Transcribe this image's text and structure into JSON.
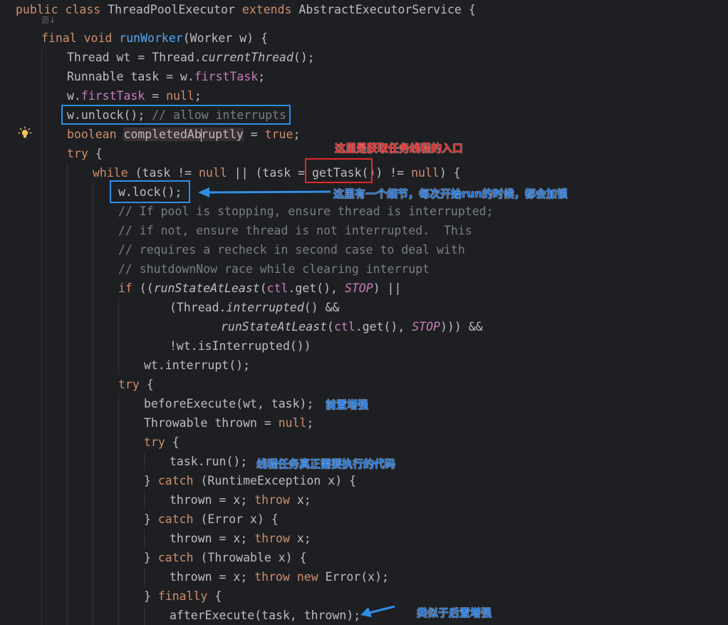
{
  "code": {
    "class_decl": {
      "kw1": "public",
      "kw2": "class",
      "name": "ThreadPoolExecutor",
      "kw3": "extends",
      "parent": "AbstractExecutorService",
      "brace": "{"
    },
    "inlay_hint": "沥↓",
    "l_sig": {
      "kw1": "final",
      "kw2": "void",
      "method": "runWorker",
      "params": "(Worker w) {"
    },
    "l_wt": {
      "a": "Thread wt = Thread.",
      "b": "currentThread",
      "c": "();"
    },
    "l_task": {
      "a": "Runnable task = w.",
      "b": "firstTask",
      "c": ";"
    },
    "l_ft": {
      "a": "w.",
      "b": "firstTask",
      "c": " = ",
      "d": "null",
      "e": ";"
    },
    "l_unlock": {
      "a": "w.unlock();",
      "b": " // allow interrupts"
    },
    "l_bool": {
      "kw": "boolean",
      "sp": " ",
      "var_a": "completedAb",
      "var_b": "ruptly",
      "rest": " = ",
      "val": "true",
      "end": ";"
    },
    "l_try1": {
      "kw": "try",
      "rest": " {"
    },
    "l_while": {
      "kw": "while",
      "a": " (task != ",
      "n1": "null",
      "b": " || (task = ",
      "c": "getTask()",
      "d": ") != ",
      "n2": "null",
      "e": ") {"
    },
    "l_lock": "w.lock();",
    "comments": [
      "// If pool is stopping, ensure thread is interrupted;",
      "// if not, ensure thread is not interrupted.  This",
      "// requires a recheck in second case to deal with",
      "// shutdownNow race while clearing interrupt"
    ],
    "l_if": {
      "kw": "if",
      "a": " ((",
      "m": "runStateAtLeast",
      "b": "(",
      "f": "ctl",
      "c": ".get(), ",
      "s": "STOP",
      "d": ") ||"
    },
    "l_thr": {
      "a": "(Thread.",
      "m": "interrupted",
      "b": "() &&"
    },
    "l_rs": {
      "m": "runStateAtLeast",
      "a": "(",
      "f": "ctl",
      "b": ".get(), ",
      "s": "STOP",
      "c": "))) &&"
    },
    "l_isint": "!wt.isInterrupted())",
    "l_wtint": "wt.interrupt();",
    "l_try2": {
      "kw": "try",
      "rest": " {"
    },
    "l_before": "beforeExecute(wt, task);",
    "l_thrown": {
      "a": "Throwable thrown = ",
      "n": "null",
      "b": ";"
    },
    "l_try3": {
      "kw": "try",
      "rest": " {"
    },
    "l_run": "task.run();",
    "l_c1": {
      "a": "} ",
      "kw": "catch",
      "b": " (RuntimeException x) {"
    },
    "l_t1": {
      "a": "thrown = x; ",
      "kw": "throw",
      "b": " x;"
    },
    "l_c2": {
      "a": "} ",
      "kw": "catch",
      "b": " (Error x) {"
    },
    "l_t2": {
      "a": "thrown = x; ",
      "kw": "throw",
      "b": " x;"
    },
    "l_c3": {
      "a": "} ",
      "kw": "catch",
      "b": " (Throwable x) {"
    },
    "l_t3": {
      "a": "thrown = x; ",
      "kw": "throw",
      "kw2": "new",
      "b": " Error(x);"
    },
    "l_fin": {
      "a": "} ",
      "kw": "finally",
      "b": " {"
    },
    "l_after": "afterExecute(task, thrown);"
  },
  "annotations": {
    "entry": "这里是获取任务线程的入口",
    "lock_detail": "这里有一个细节，每次开始run的时候，都会加锁",
    "pre_enhance": "前置增强",
    "real_task": "线程任务真正需要执行的代码",
    "post_enhance": "类似于后置增强"
  },
  "colors": {
    "background": "#1e1f22",
    "keyword": "#cf8e6d",
    "method": "#56a8f5",
    "field": "#c77dbb",
    "comment": "#7a7e85",
    "annotation_blue": "#1a6fd6",
    "annotation_red": "#e02222",
    "box_blue": "#2f8ee6",
    "box_red": "#e02a2a"
  },
  "icons": {
    "gutter": "lightbulb-icon",
    "arrows": "arrow-icon"
  }
}
